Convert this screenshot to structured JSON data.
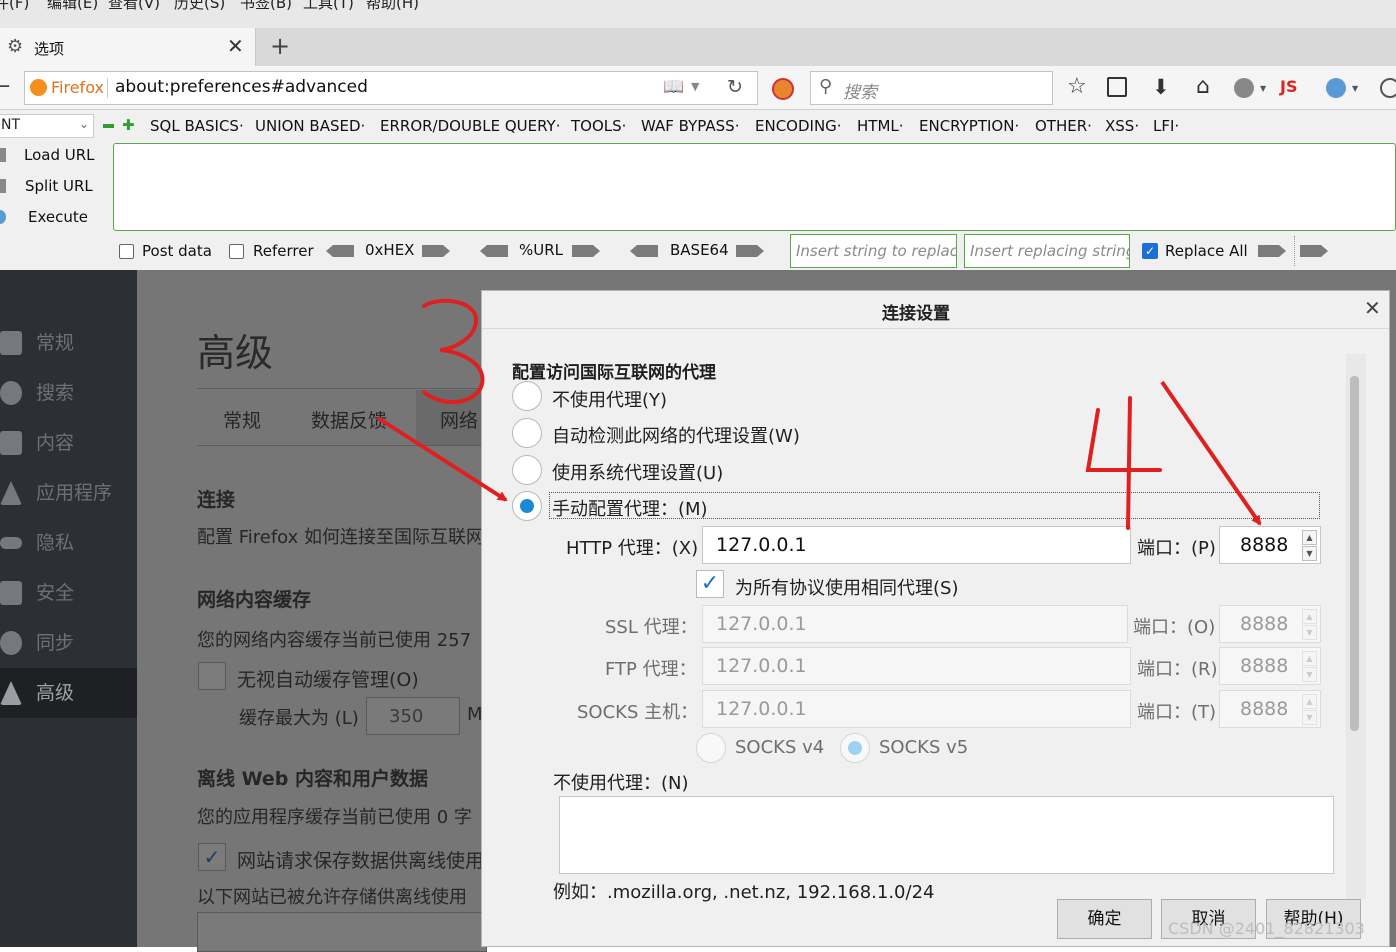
{
  "menubar": [
    "件(F)",
    "编辑(E)",
    "查看(V)",
    "历史(S)",
    "书签(B)",
    "工具(T)",
    "帮助(H)"
  ],
  "tab": {
    "title": "选项"
  },
  "nav": {
    "brand": "Firefox",
    "url": "about:preferences#advanced",
    "search_placeholder": "搜索",
    "js_badge": "JS"
  },
  "hackbar": {
    "select_value": "NT",
    "menus": [
      "SQL BASICS·",
      "UNION BASED·",
      "ERROR/DOUBLE QUERY·",
      "TOOLS·",
      "WAF BYPASS·",
      "ENCODING·",
      "HTML·",
      "ENCRYPTION·",
      "OTHER·",
      "XSS·",
      "LFI·"
    ],
    "load_url": "Load URL",
    "split_url": "Split URL",
    "execute": "Execute",
    "post_data": "Post data",
    "referrer": "Referrer",
    "hex": "0xHEX",
    "url_enc": "%URL",
    "base64": "BASE64",
    "find_placeholder": "Insert string to replace",
    "replace_placeholder": "Insert replacing string",
    "replace_all": "Replace All"
  },
  "sidebar": [
    {
      "label": "常规"
    },
    {
      "label": "搜索"
    },
    {
      "label": "内容"
    },
    {
      "label": "应用程序"
    },
    {
      "label": "隐私"
    },
    {
      "label": "安全"
    },
    {
      "label": "同步"
    },
    {
      "label": "高级"
    }
  ],
  "content": {
    "heading": "高级",
    "tabs": [
      "常规",
      "数据反馈",
      "网络"
    ],
    "connection_title": "连接",
    "connection_desc": "配置 Firefox 如何连接至国际互联网",
    "cache_title": "网络内容缓存",
    "cache_desc": "您的网络内容缓存当前已使用 257",
    "cache_override": "无视自动缓存管理(O)",
    "cache_limit_label": "缓存最大为 (L)",
    "cache_limit_value": "350",
    "cache_unit": "M",
    "offline_title": "离线 Web 内容和用户数据",
    "offline_desc": "您的应用程序缓存当前已使用 0 字",
    "offline_notify": "网站请求保存数据供离线使用",
    "offline_allowed": "以下网站已被允许存储供离线使用"
  },
  "dialog": {
    "title": "连接设置",
    "section": "配置访问国际互联网的代理",
    "options": [
      "不使用代理(Y)",
      "自动检测此网络的代理设置(W)",
      "使用系统代理设置(U)",
      "手动配置代理：(M)"
    ],
    "http_label": "HTTP 代理：(X)",
    "http_value": "127.0.0.1",
    "port_label": "端口：(P)",
    "http_port": "8888",
    "same_proxy": "为所有协议使用相同代理(S)",
    "ssl_label": "SSL 代理：",
    "ssl_value": "127.0.0.1",
    "ssl_port_label": "端口：(O)",
    "ssl_port": "8888",
    "ftp_label": "FTP 代理：",
    "ftp_value": "127.0.0.1",
    "ftp_port_label": "端口：(R)",
    "ftp_port": "8888",
    "socks_label": "SOCKS 主机：",
    "socks_value": "127.0.0.1",
    "socks_port_label": "端口：(T)",
    "socks_port": "8888",
    "socks4": "SOCKS v4",
    "socks5": "SOCKS v5",
    "no_proxy_label": "不使用代理：(N)",
    "example": "例如：.mozilla.org, .net.nz, 192.168.1.0/24",
    "ok": "确定",
    "cancel": "取消",
    "help": "帮助(H)"
  },
  "annotations": {
    "three": "3",
    "four": "4",
    "color": "#e02020"
  },
  "watermark": "CSDN @2401_82821303"
}
